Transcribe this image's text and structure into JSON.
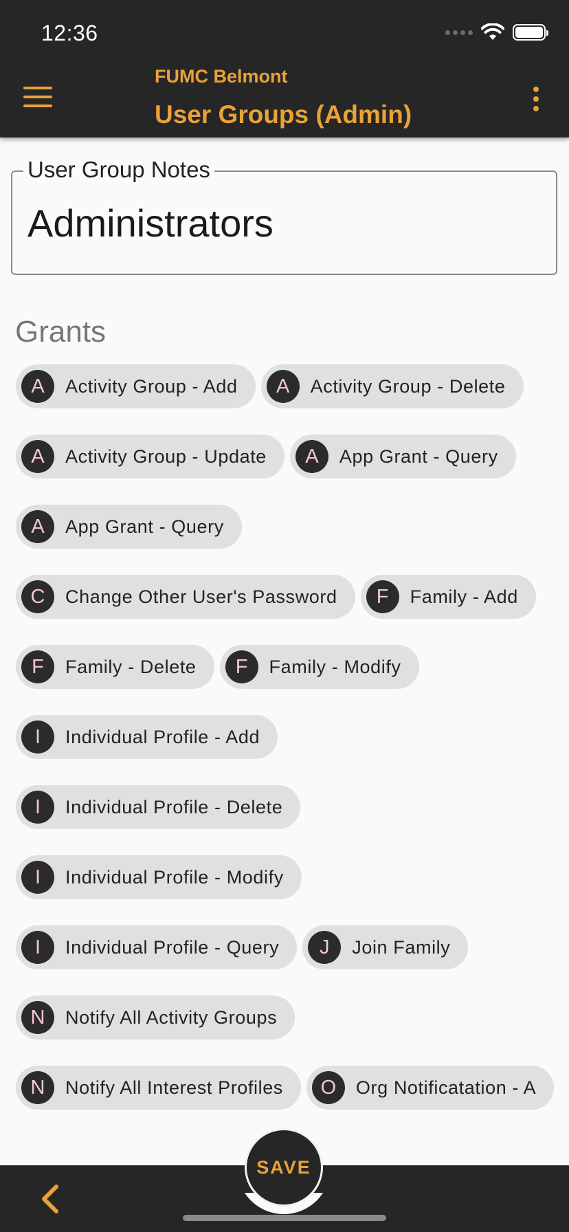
{
  "status": {
    "time": "12:36"
  },
  "appbar": {
    "subtitle": "FUMC Belmont",
    "title": "User Groups (Admin)",
    "menu_icon": "hamburger-menu-icon",
    "overflow_icon": "vertical-dots-icon"
  },
  "notes": {
    "label": "User Group Notes",
    "value": "Administrators"
  },
  "grants": {
    "heading": "Grants",
    "items": [
      {
        "initial": "A",
        "label": "Activity Group - Add"
      },
      {
        "initial": "A",
        "label": "Activity Group - Delete"
      },
      {
        "initial": "A",
        "label": "Activity Group - Update"
      },
      {
        "initial": "A",
        "label": "App Grant - Query"
      },
      {
        "initial": "A",
        "label": "App Grant - Query"
      },
      {
        "initial": "C",
        "label": "Change Other User's Password"
      },
      {
        "initial": "F",
        "label": "Family - Add"
      },
      {
        "initial": "F",
        "label": "Family - Delete"
      },
      {
        "initial": "F",
        "label": "Family - Modify"
      },
      {
        "initial": "I",
        "label": "Individual Profile - Add"
      },
      {
        "initial": "I",
        "label": "Individual Profile - Delete"
      },
      {
        "initial": "I",
        "label": "Individual Profile - Modify"
      },
      {
        "initial": "I",
        "label": "Individual Profile - Query"
      },
      {
        "initial": "J",
        "label": "Join Family"
      },
      {
        "initial": "N",
        "label": "Notify All Activity Groups"
      },
      {
        "initial": "N",
        "label": "Notify All Interest Profiles"
      },
      {
        "initial": "O",
        "label": "Org Notificatation - A"
      }
    ]
  },
  "bottombar": {
    "save_label": "SAVE",
    "back_icon": "chevron-left-icon"
  },
  "colors": {
    "accent": "#e8a23a",
    "bar_background": "#262626",
    "chip_background": "#e0e0e0",
    "avatar_background": "#2b2b2b",
    "avatar_text": "#f4c6cf"
  }
}
